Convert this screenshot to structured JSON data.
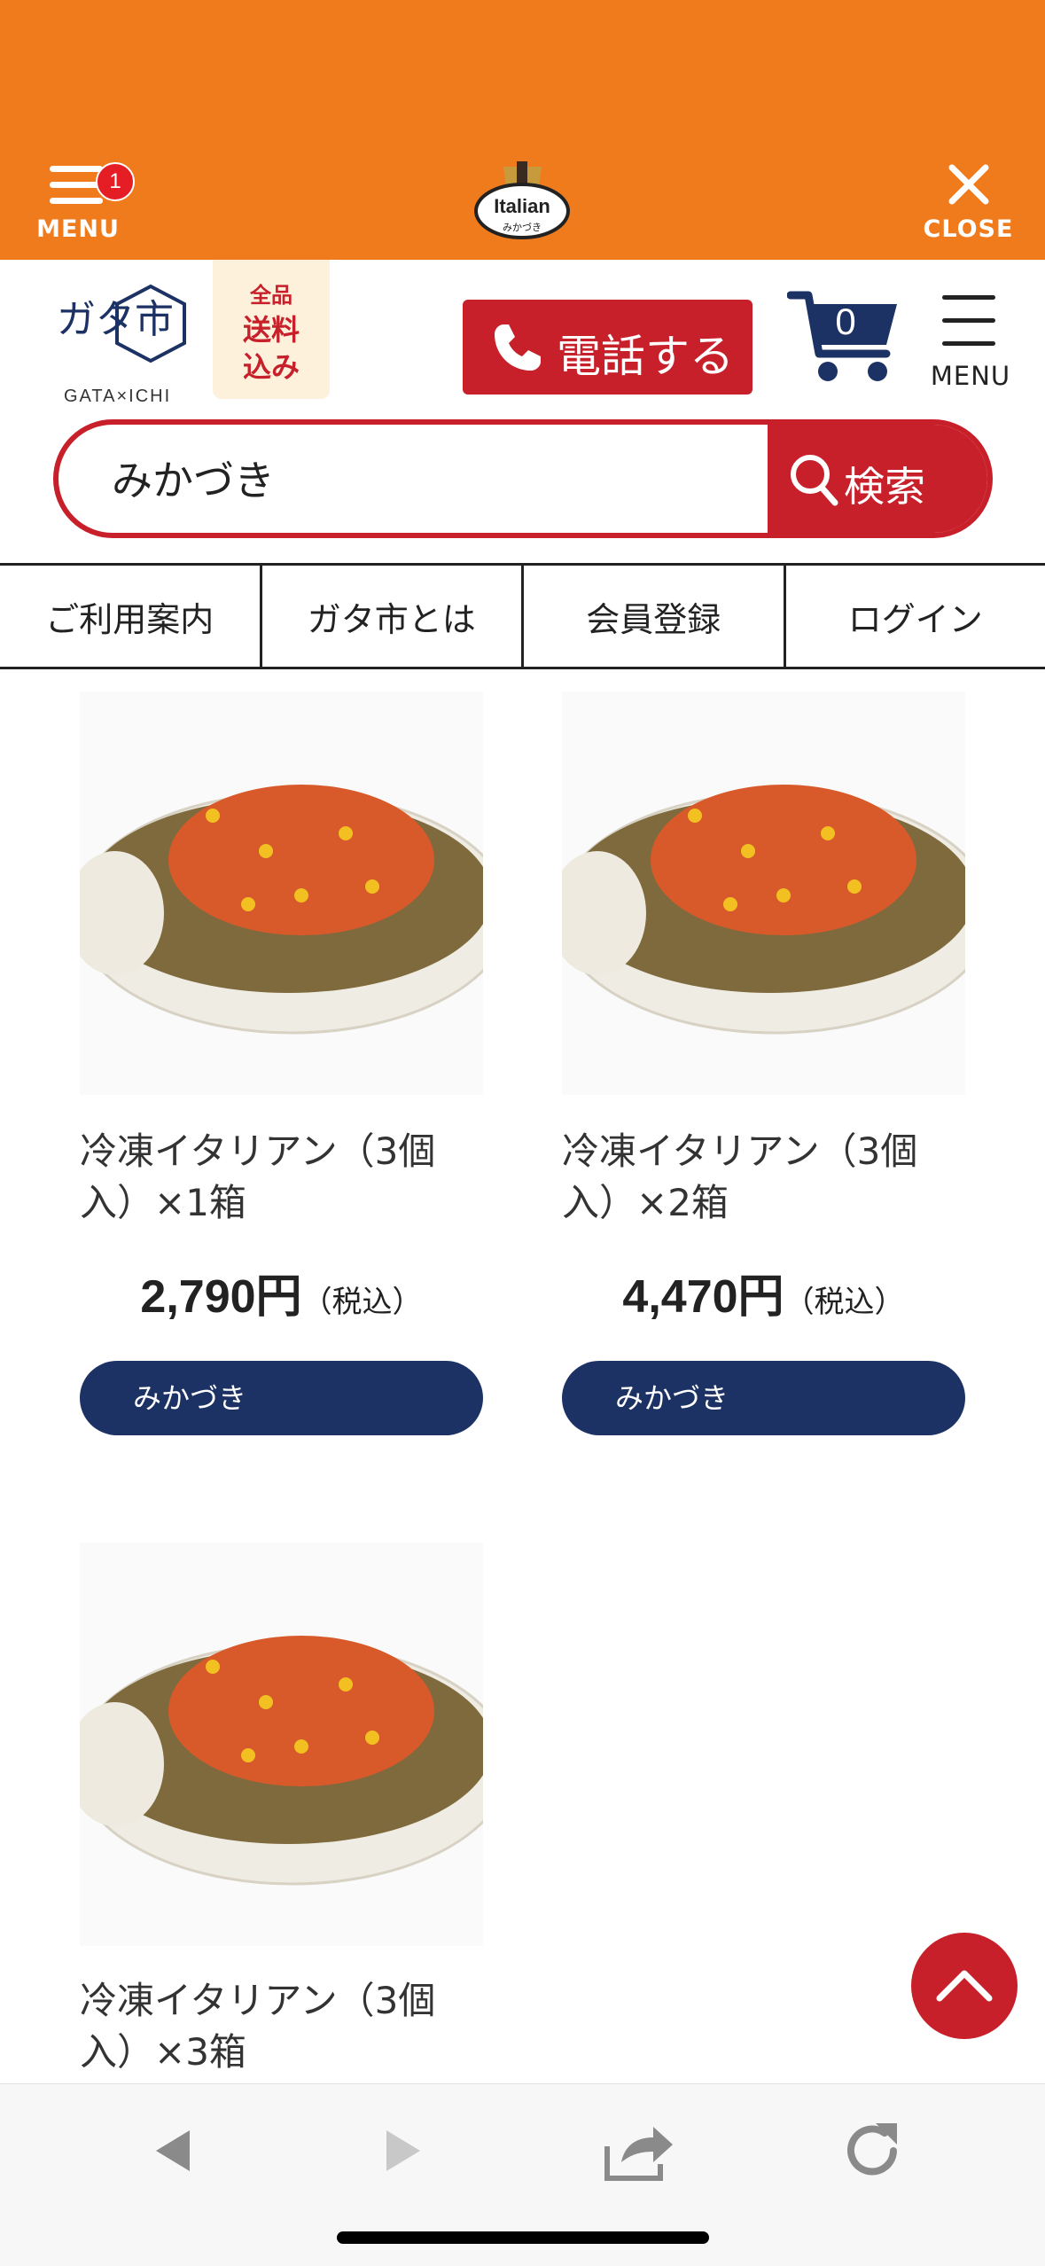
{
  "topbar": {
    "menu_label": "MENU",
    "menu_badge": "1",
    "logo_text_top": "Italian",
    "logo_text_bottom": "みかづき",
    "close_label": "CLOSE"
  },
  "header": {
    "logo_main": "ガタ市",
    "logo_romaji": "GATA×ICHI",
    "free_shipping": {
      "line1": "全品",
      "line2": "送料",
      "line3": "込み"
    },
    "call_button": "電話する",
    "cart_count": "0",
    "menu_label": "MENU"
  },
  "search": {
    "value": "みかづき",
    "button_label": "検索"
  },
  "nav": {
    "items": [
      "ご利用案内",
      "ガタ市とは",
      "会員登録",
      "ログイン"
    ]
  },
  "products": [
    {
      "name": "冷凍イタリアン（3個入）×1箱",
      "price": "2,790円",
      "tax": "（税込）",
      "maker": "みかづき"
    },
    {
      "name": "冷凍イタリアン（3個入）×2箱",
      "price": "4,470円",
      "tax": "（税込）",
      "maker": "みかづき"
    },
    {
      "name": "冷凍イタリアン（3個入）×3箱"
    }
  ],
  "colors": {
    "topbar": "#f07b1d",
    "accent_red": "#c8202a",
    "navy": "#1c3264"
  },
  "icons": {
    "topbar_menu": "hamburger-icon",
    "topbar_close": "close-icon",
    "call": "phone-icon",
    "cart": "cart-icon",
    "search": "search-icon",
    "to_top": "chevron-up-icon",
    "back": "back-arrow-icon",
    "forward": "forward-arrow-icon",
    "share": "share-icon",
    "reload": "reload-icon"
  }
}
